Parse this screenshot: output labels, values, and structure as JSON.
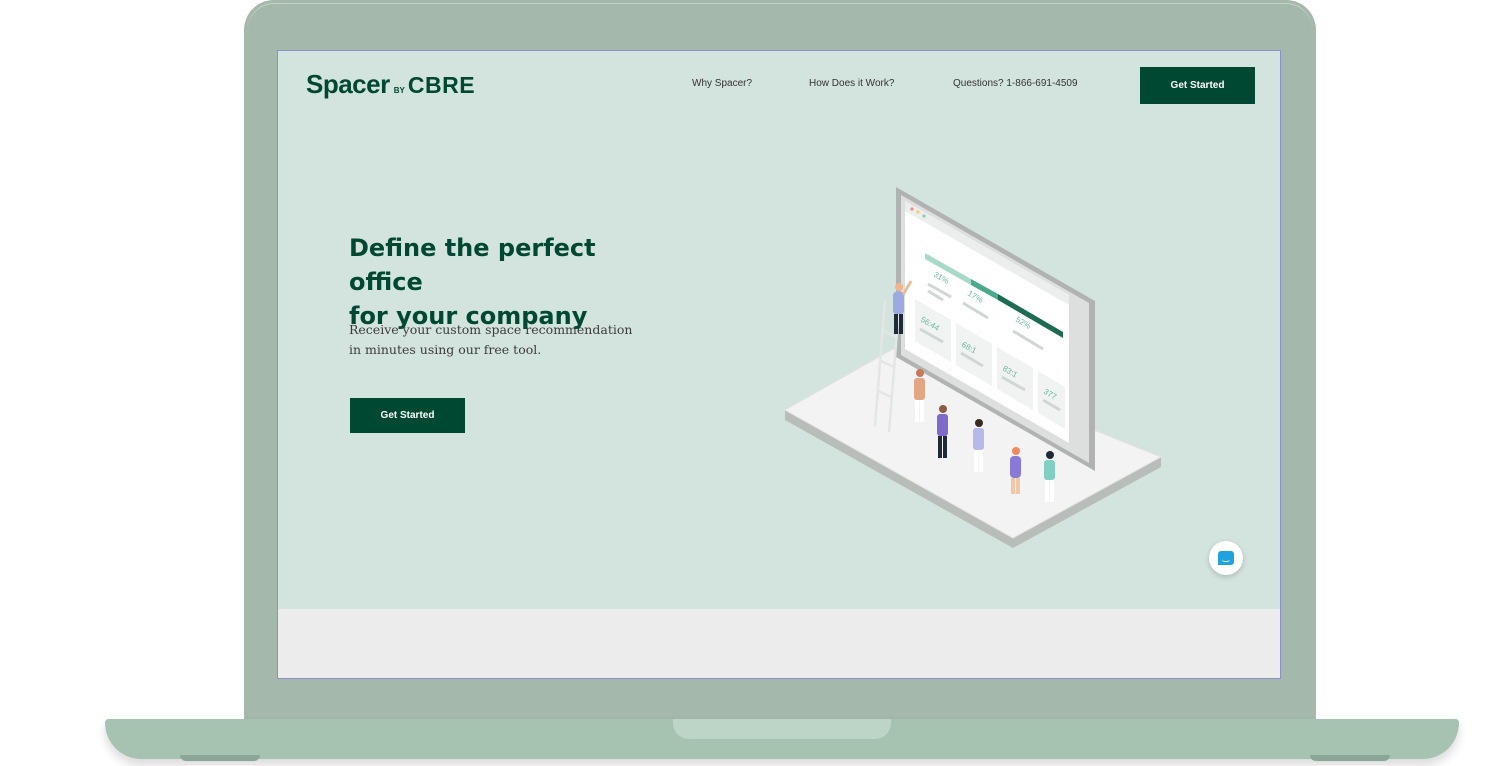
{
  "header": {
    "logo": {
      "primary": "Spacer",
      "by": "BY",
      "brand": "CBRE"
    },
    "nav": [
      {
        "label": "Why Spacer?"
      },
      {
        "label": "How Does it Work?"
      },
      {
        "label": "Questions? 1-866-691-4509"
      }
    ],
    "cta_label": "Get Started"
  },
  "hero": {
    "headline_line1": "Define the perfect office",
    "headline_line2": "for your company",
    "subtext_line1": "Receive your custom space recommendation",
    "subtext_line2": "in minutes using our free tool.",
    "cta_label": "Get Started"
  },
  "illustration": {
    "metrics": [
      "31%",
      "17%",
      "52%",
      "56:44",
      "68:1",
      "83:1",
      "377"
    ]
  },
  "chat": {
    "icon": "chat-bubble-icon"
  },
  "colors": {
    "brand": "#004831",
    "hero_background": "#d3e3dd",
    "device_frame": "#a4b8ac",
    "chat_accent": "#1fa3de"
  }
}
